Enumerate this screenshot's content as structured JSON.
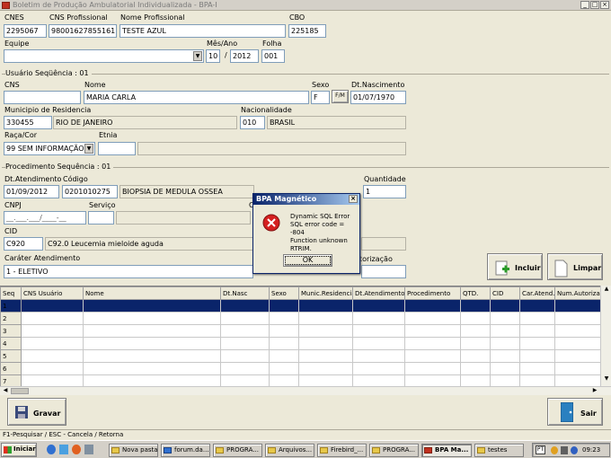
{
  "window": {
    "title": "Boletim de Produção Ambulatorial Individualizada - BPA-I",
    "controls": [
      "_",
      "□",
      "×"
    ]
  },
  "header": {
    "cnes_label": "CNES",
    "cnes": "2295067",
    "cns_prof_label": "CNS Profissional",
    "cns_prof": "980016278551611",
    "nome_prof_label": "Nome Profissional",
    "nome_prof": "TESTE AZUL",
    "cbo_label": "CBO",
    "cbo": "225185",
    "equipe_label": "Equipe",
    "equipe": "",
    "mesano_label": "Mês/Ano",
    "mes": "10",
    "sep": "/",
    "ano": "2012",
    "folha_label": "Folha",
    "folha": "001"
  },
  "usuario": {
    "section": "Usuário Seqüência : 01",
    "cns_label": "CNS",
    "cns": "",
    "nome_label": "Nome",
    "nome": "MARIA CARLA",
    "sexo_label": "Sexo",
    "sexo": "F",
    "fm_button": "F/M",
    "nasc_label": "Dt.Nascimento",
    "nasc": "01/07/1970",
    "mun_label": "Municipio de Residencia",
    "mun_code": "330455",
    "mun_name": "RIO DE JANEIRO",
    "nac_label": "Nacionalidade",
    "nac_code": "010",
    "nac_name": "BRASIL",
    "raca_label": "Raça/Cor",
    "raca": "99 SEM INFORMAÇÃO",
    "etnia_label": "Etnia",
    "etnia": ""
  },
  "procedimento": {
    "section": "Procedimento Sequência : 01",
    "dt_label": "Dt.Atendimento",
    "dt": "01/09/2012",
    "codigo_label": "Código",
    "codigo": "0201010275",
    "desc": "BIOPSIA DE MEDULA OSSEA",
    "qtd_label": "Quantidade",
    "qtd": "1",
    "cnpj_label": "CNPJ",
    "cnpj": "__.___.___/____-__",
    "servico_label": "Serviço",
    "servico": "",
    "c_label": "C",
    "cid_label": "CID",
    "cid_code": "C920",
    "cid_desc": "C92.0 Leucemia mieloide aguda",
    "carater_label": "Caráter Atendimento",
    "carater": "1 - ELETIVO",
    "autorizacao_label": "torização"
  },
  "buttons": {
    "incluir": "Incluir",
    "limpar": "Limpar",
    "gravar": "Gravar",
    "sair": "Sair"
  },
  "grid": {
    "columns": [
      "Seq",
      "CNS Usuário",
      "Nome",
      "Dt.Nasc",
      "Sexo",
      "Munic.Residencia",
      "Dt.Atendimento",
      "Procedimento",
      "QTD.",
      "CID",
      "Car.Atend.",
      "Num.Autorizaç"
    ],
    "rows": [
      "1",
      "2",
      "3",
      "4",
      "5",
      "6",
      "7"
    ]
  },
  "dialog": {
    "title": "BPA Magnético",
    "line1": "Dynamic SQL Error",
    "line2": "SQL error code = -804",
    "line3": "Function unknown",
    "line4": "RTRIM.",
    "ok": "OK"
  },
  "statusbar": {
    "text": "F1-Pesquisar  / ESC - Cancela / Retorna"
  },
  "taskbar": {
    "start": "Iniciar",
    "tasks": [
      "Nova pasta",
      "forum.da...",
      "PROGRA...",
      "Arquivos...",
      "Firebird_...",
      "PROGRA...",
      "BPA Ma...",
      "testes"
    ],
    "lang": "PT",
    "clock": "09:23"
  },
  "colors": {
    "selection": "#0a246a",
    "error": "#d42020",
    "window": "#ece9d8"
  }
}
